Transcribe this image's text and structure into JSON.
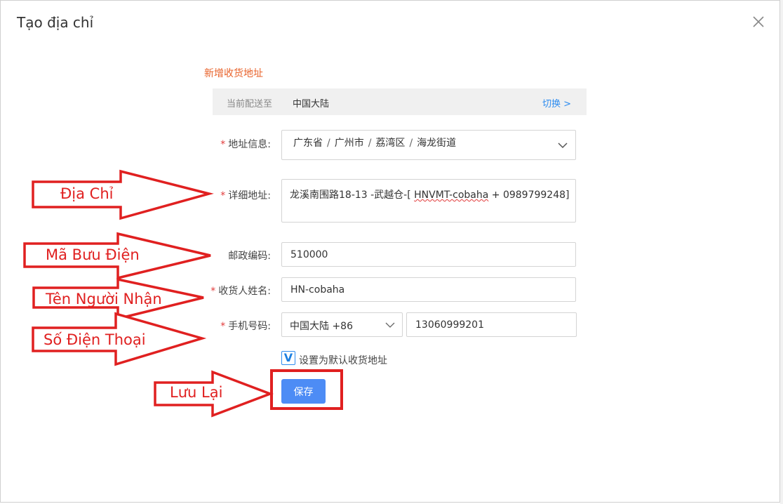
{
  "dialog": {
    "title": "Tạo địa chỉ",
    "close_icon": "close-icon"
  },
  "form": {
    "section_title": "新增收货地址",
    "ship_to": {
      "label": "当前配送至",
      "value": "中国大陆",
      "switch_label": "切换 >"
    },
    "address_info": {
      "label": "地址信息:",
      "required": true,
      "parts": [
        "广东省",
        "广州市",
        "荔湾区",
        "海龙街道"
      ],
      "separator": "/"
    },
    "detail_address": {
      "label": "详细地址:",
      "required": true,
      "value_prefix": "龙溪南围路18-13 -武越仓-[ ",
      "value_underlined": "HNVMT-cobaha",
      "value_suffix": " + 0989799248]"
    },
    "postal_code": {
      "label": "邮政编码:",
      "required": false,
      "value": "510000"
    },
    "receiver_name": {
      "label": "收货人姓名:",
      "required": true,
      "value": "HN-cobaha"
    },
    "phone": {
      "label": "手机号码:",
      "required": true,
      "country_value": "中国大陆 +86",
      "number_value": "13060999201"
    },
    "default_address": {
      "checked": true,
      "check_mark": "V",
      "label": "设置为默认收货地址"
    },
    "save_label": "保存"
  },
  "annotations": {
    "address": "Địa Chỉ",
    "postal": "Mã Bưu Điện",
    "receiver": "Tên Người Nhận",
    "phone": "Số Điện Thoại",
    "save": "Lưu Lại"
  },
  "colors": {
    "accent_orange": "#e8622a",
    "link_blue": "#2d8cf0",
    "button_blue": "#4d8cf5",
    "required_red": "#e23b3b",
    "annotation_red": "#e02020"
  }
}
